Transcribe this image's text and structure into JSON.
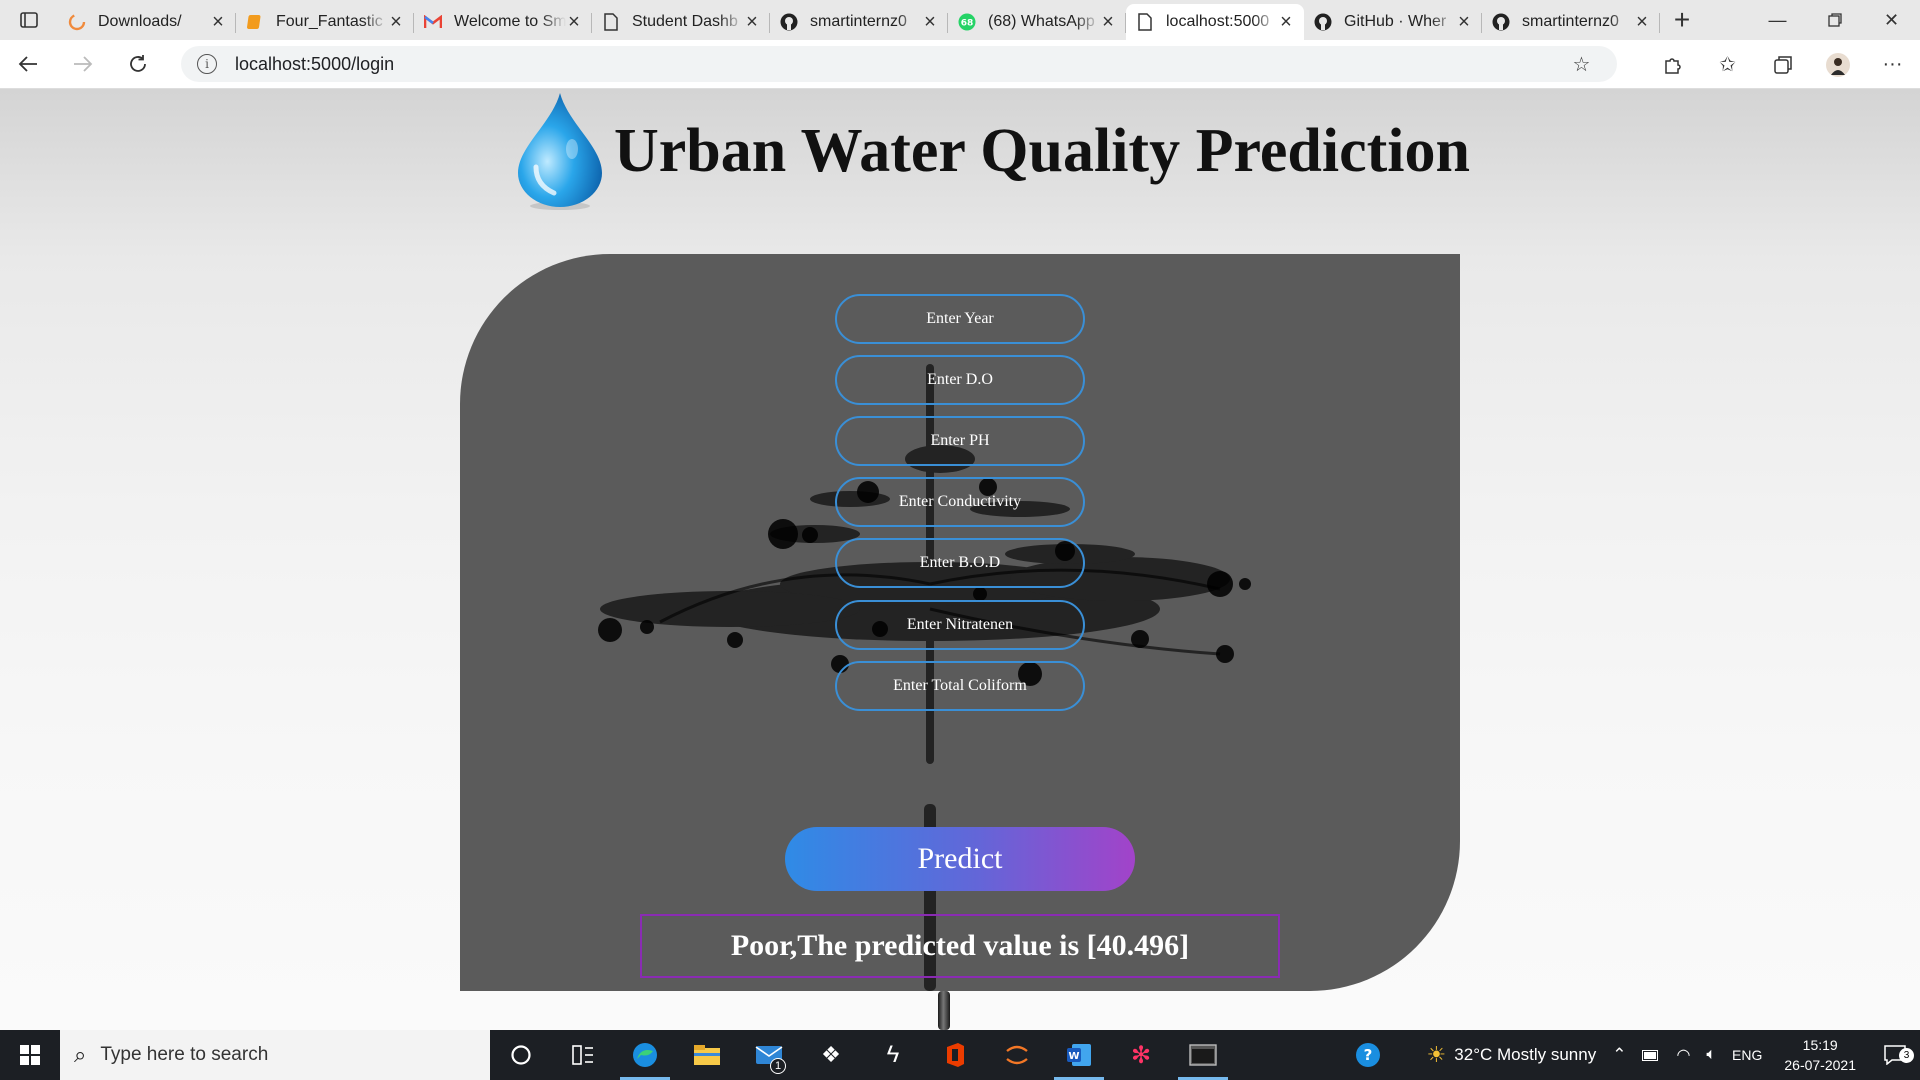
{
  "browser": {
    "tabs": [
      {
        "title": "Downloads/",
        "icon": "spinner-icon",
        "active": false
      },
      {
        "title": "Four_Fantastic",
        "icon": "slides-icon",
        "active": false
      },
      {
        "title": "Welcome to Sm",
        "icon": "gmail-icon",
        "active": false
      },
      {
        "title": "Student Dashb",
        "icon": "page-icon",
        "active": false
      },
      {
        "title": "smartinternz0",
        "icon": "github-icon",
        "active": false
      },
      {
        "title": "(68) WhatsApp",
        "icon": "whatsapp-icon",
        "active": false
      },
      {
        "title": "localhost:5000",
        "icon": "page-icon",
        "active": true
      },
      {
        "title": "GitHub · Wher",
        "icon": "github-icon",
        "active": false
      },
      {
        "title": "smartinternz0",
        "icon": "github-icon",
        "active": false
      }
    ],
    "whatsapp_badge": "68",
    "url": "localhost:5000/login"
  },
  "page": {
    "title": "Urban Water Quality Prediction",
    "inputs": [
      {
        "name": "year-input",
        "placeholder": "Enter Year"
      },
      {
        "name": "do-input",
        "placeholder": "Enter D.O"
      },
      {
        "name": "ph-input",
        "placeholder": "Enter PH"
      },
      {
        "name": "conductivity-input",
        "placeholder": "Enter Conductivity"
      },
      {
        "name": "bod-input",
        "placeholder": "Enter B.O.D"
      },
      {
        "name": "nitratenen-input",
        "placeholder": "Enter Nitratenen"
      },
      {
        "name": "total-coliform-input",
        "placeholder": "Enter Total Coliform"
      }
    ],
    "predict_label": "Predict",
    "result_text": "Poor,The predicted value is [40.496]"
  },
  "taskbar": {
    "search_placeholder": "Type here to search",
    "apps": [
      "cortana-icon",
      "task-view-icon",
      "edge-icon",
      "file-explorer-icon",
      "mail-icon",
      "dropbox-icon",
      "power-automate-icon",
      "office-icon",
      "jupyter-icon",
      "word-icon",
      "settings-gear-icon",
      "terminal-icon"
    ],
    "mail_badge": "1",
    "weather": "32°C  Mostly sunny",
    "language": "ENG",
    "time": "15:19",
    "date": "26-07-2021",
    "notifications": "3"
  },
  "colors": {
    "card": "#5b5b5b",
    "field_border": "#3a8fd6",
    "predict_gradient": [
      "#2f8be6",
      "#a243c9"
    ],
    "result_border": "#8a2bb3"
  }
}
